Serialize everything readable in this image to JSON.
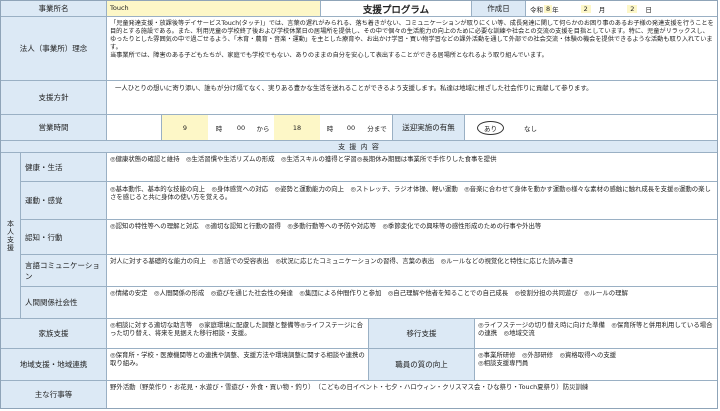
{
  "header": {
    "office_label": "事業所名",
    "office_name": "Touch",
    "title": "支援プログラム",
    "created_label": "作成日",
    "era": "令和",
    "year": "8",
    "year_unit": "年",
    "month": "2",
    "month_unit": "月",
    "day": "2",
    "day_unit": "日"
  },
  "philosophy": {
    "label": "法人（事業所）理念",
    "text": "「児童発達支援・放課後等デイサービスTouch(タッチ)」では、言葉の遅れがみられる、落ち着きがない、コミュニケーションが取りにくい等、成長発達に関して何らかのお困り事のあるお子様の発達支援を行うことを目的とする施設である。また、利用児童の学校終了後および学校休業日の居場所を提供し、その中で個々の生活能力の向上のために必要な訓練や社会との交流の支援を目指としています。特に、児童がリラックスし、ゆったりとした雰囲気の中で過ごせるよう、「木育・農育・音楽・運動」を主とした療育や、お出かけ学習・買い物学習などの課外活動を通して外部での社会交流・体験の機会を提供できるような活動も取り入れています。\n当事業所では、障害のある子どもたちが、家庭でも学校でもない、ありのままの自分を安心して表出することができる居場所となれるよう取り組んでいます。"
  },
  "policy": {
    "label": "支援方針",
    "text": "一人ひとりの想いに寄り添い、誰もが分け隔てなく、実りある豊かな生活を送れることができるよう支援します。私達は地域に根ざした社会作りに貢献して参ります。"
  },
  "hours": {
    "label": "営業時間",
    "start_h": "9",
    "hour_unit1": "時",
    "start_m": "00",
    "from": "から",
    "end_h": "18",
    "hour_unit2": "時",
    "end_m": "00",
    "until": "分まで",
    "transport_label": "送迎実施の有無",
    "transport_yes": "あり",
    "transport_no": "なし"
  },
  "support": {
    "header": "支 援 内 容",
    "side_label": "本人支援",
    "items": [
      {
        "label": "健康・生活",
        "text": "◎健康状態の確認と維持　◎生活習慣や生活リズムの形成　◎生活スキルの獲得と学習◎長期休み期間は事業所で手作りした食事を提供"
      },
      {
        "label": "運動・感覚",
        "text": "◎基本動作、基本的な技能の向上　◎身体感覚への対応　◎姿勢と運動能力の向上　◎ストレッチ、ラジオ体操、軽い運動　◎音楽に合わせて身体を動かす運動◎様々な素材の感触に触れ成長を支援◎運動の楽しさを感じると共に身体の使い方を覚える。"
      },
      {
        "label": "認知・行動",
        "text": "◎認知の特性等への理解と対応　◎適切な認知と行動の習得　◎多動行動等への予防や対応等　◎季節変化での興味等の感性形成のための行事や外出等"
      },
      {
        "label": "言語コミュニケーション",
        "text": "対人に対する基礎的な能力の向上　◎言語での受容表出　◎状況に応じたコミュニケーションの習得、言葉の表出　◎ルールなどの視覚化と特性に応じた読み書き"
      },
      {
        "label": "人間関係社会性",
        "text": "◎情緒の安定　◎人間関係の形成　◎遊びを通じた社会性の発達　◎集団による仲間作りと参加　◎自己理解や他者を知ることでの自己成長　◎役割分担の共同遊び　◎ルールの理解"
      }
    ]
  },
  "family": {
    "label": "家族支援",
    "text": "◎相談に対する適切な助言等　◎家庭環境に配慮した調整と整備等◎ライフステージに合った切り替え、将来を見据えた移行相談・支援。",
    "transition_label": "移行支援",
    "transition_text": "◎ライフステージの切り替え時に向けた準備　◎保育所等と併用利用している場合の連携　◎地域交流"
  },
  "community": {
    "label": "地域支援・地域連携",
    "text": "◎保育所・学校・医療機関等との連携や調整、支援方法や環境調整に関する相談や連携の取り組み。",
    "staff_label": "職員の質の向上",
    "staff_text": "◎事業所研修　◎外部研修　◎資格取得への支援\n◎相談支援専門員"
  },
  "events": {
    "label": "主な行事等",
    "text": "野外活動（野菜作り・お花見・水遊び・雪遊び・外食・買い物・釣り）　（こどもの日イベント・七夕・ハロウィン・クリスマス会・ひな祭り・Touch夏祭り）防災訓練"
  }
}
